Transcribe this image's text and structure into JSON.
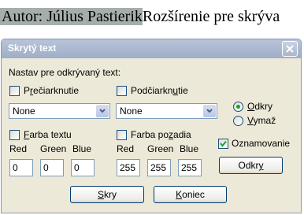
{
  "document": {
    "selected_text": "Autor: Július Pastierik",
    "following_text": "Rozšírenie pre skrýva"
  },
  "dialog": {
    "title": "Skrytý text",
    "instruction": "Nastav pre odkrývaný text:",
    "strikethrough": {
      "label_before": "P",
      "label_accel": "r",
      "label_after": "ečiarknutie",
      "checked": false
    },
    "underline": {
      "label_before": "Podčiarkn",
      "label_accel": "u",
      "label_after": "tie",
      "checked": false
    },
    "strike_select": {
      "value": "None"
    },
    "underline_select": {
      "value": "None"
    },
    "text_color": {
      "label_before": "",
      "label_accel": "F",
      "label_after": "arba textu",
      "checked": false,
      "red_label": "Red",
      "green_label": "Green",
      "blue_label": "Blue",
      "red": "0",
      "green": "0",
      "blue": "0"
    },
    "bg_color": {
      "label_before": "Farba po",
      "label_accel": "z",
      "label_after": "adia",
      "checked": false,
      "red_label": "Red",
      "green_label": "Green",
      "blue_label": "Blue",
      "red": "255",
      "green": "255",
      "blue": "255"
    },
    "radio_reveal": {
      "label_before": "",
      "label_accel": "O",
      "label_after": "dkry",
      "selected": true
    },
    "radio_delete": {
      "label_before": "",
      "label_accel": "V",
      "label_after": "ymaž",
      "selected": false
    },
    "notify": {
      "label": "Oznamovanie",
      "checked": true
    },
    "reveal_button": {
      "label_before": "Odkr",
      "label_accel": "y",
      "label_after": ""
    },
    "hide_button": {
      "label_before": "",
      "label_accel": "S",
      "label_after": "kry"
    },
    "end_button": {
      "label_before": "",
      "label_accel": "K",
      "label_after": "oniec"
    }
  },
  "colors": {
    "accent": "#003c74",
    "title_bar": "#9eaec8",
    "dialog_bg": "#ece9d8"
  },
  "icons": {
    "close": "close-icon",
    "dropdown": "chevron-down-icon",
    "check": "check-icon"
  }
}
